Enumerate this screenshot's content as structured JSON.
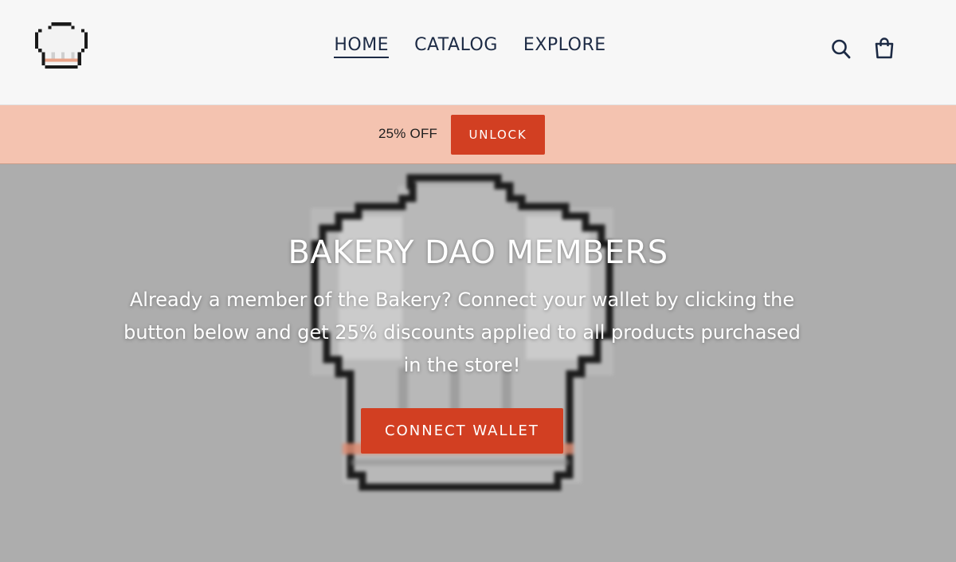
{
  "header": {
    "logo_icon": "chef-hat-icon",
    "nav": [
      {
        "label": "HOME",
        "active": true
      },
      {
        "label": "CATALOG",
        "active": false
      },
      {
        "label": "EXPLORE",
        "active": false
      }
    ],
    "icons": [
      "search-icon",
      "shopping-bag-icon"
    ]
  },
  "promo": {
    "text": "25% OFF",
    "button_label": "UNLOCK"
  },
  "hero": {
    "background_icon": "chef-hat-pixel-art",
    "title": "BAKERY DAO MEMBERS",
    "body": "Already a member of the Bakery? Connect your wallet by clicking the button below and get 25% discounts applied to all products purchased in the store!",
    "button_label": "CONNECT WALLET"
  },
  "colors": {
    "header_bg": "#f7f7f7",
    "nav_text": "#1d2b45",
    "promo_bg": "#f4c3b0",
    "accent": "#d23f22",
    "hero_bg": "#adadad",
    "hero_text": "#ffffff"
  }
}
